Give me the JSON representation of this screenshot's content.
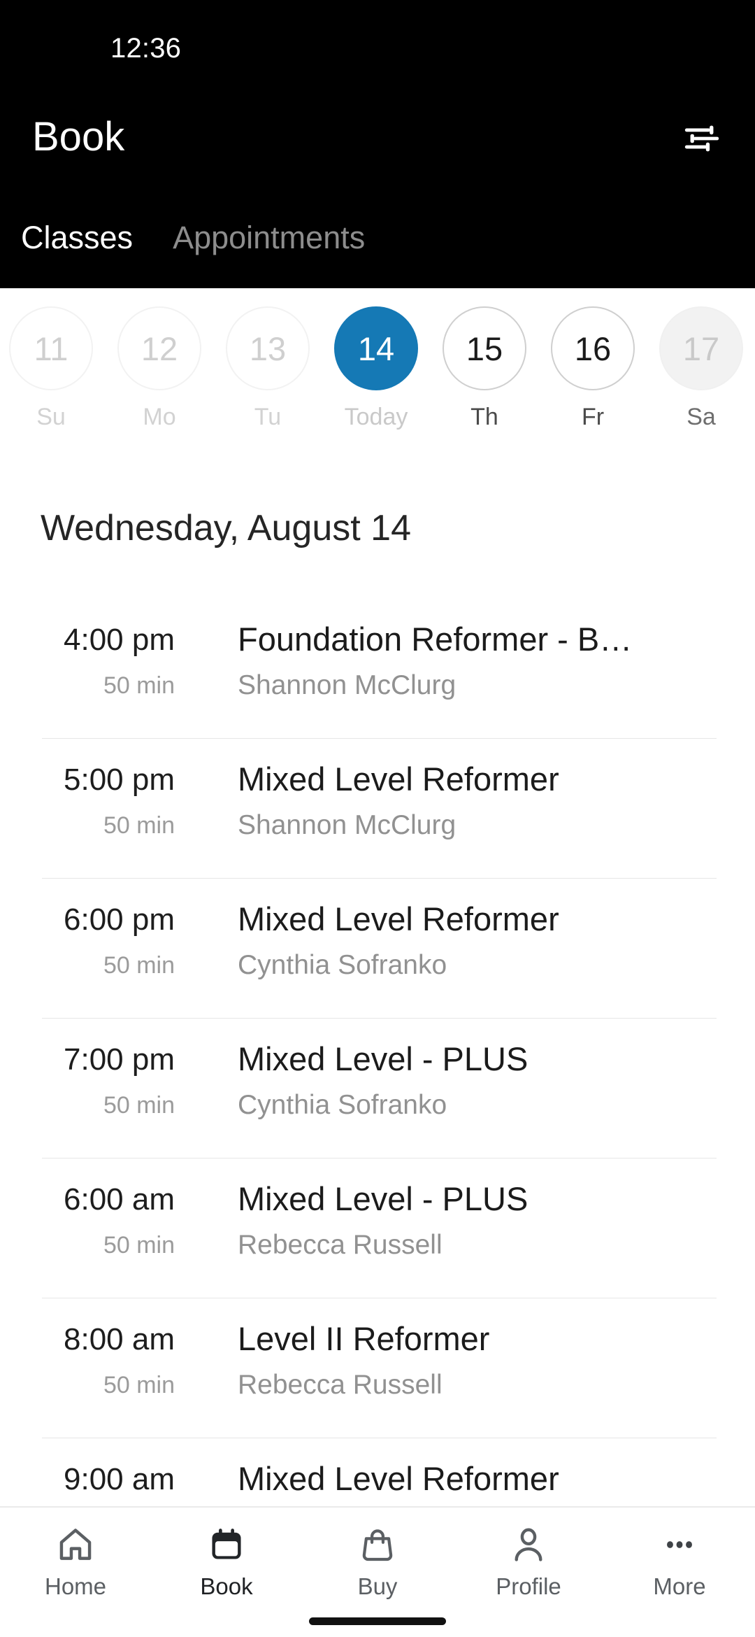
{
  "status_bar": {
    "time": "12:36"
  },
  "header": {
    "title": "Book",
    "filter_icon": "tune-filter-icon"
  },
  "tabs": [
    {
      "label": "Classes",
      "active": true
    },
    {
      "label": "Appointments",
      "active": false
    }
  ],
  "date_strip": {
    "days": [
      {
        "num": "11",
        "label": "Su",
        "state": "past"
      },
      {
        "num": "12",
        "label": "Mo",
        "state": "past"
      },
      {
        "num": "13",
        "label": "Tu",
        "state": "past"
      },
      {
        "num": "14",
        "label": "Today",
        "state": "selected"
      },
      {
        "num": "15",
        "label": "Th",
        "state": "avail"
      },
      {
        "num": "16",
        "label": "Fr",
        "state": "avail"
      },
      {
        "num": "17",
        "label": "Sa",
        "state": "filled"
      }
    ]
  },
  "day_heading": "Wednesday, August 14",
  "classes": [
    {
      "time": "4:00 pm",
      "duration": "50 min",
      "name": "Foundation Reformer - B…",
      "staff": "Shannon McClurg"
    },
    {
      "time": "5:00 pm",
      "duration": "50 min",
      "name": "Mixed Level Reformer",
      "staff": "Shannon McClurg"
    },
    {
      "time": "6:00 pm",
      "duration": "50 min",
      "name": "Mixed Level Reformer",
      "staff": "Cynthia Sofranko"
    },
    {
      "time": "7:00 pm",
      "duration": "50 min",
      "name": "Mixed Level - PLUS",
      "staff": "Cynthia Sofranko"
    },
    {
      "time": "6:00 am",
      "duration": "50 min",
      "name": "Mixed Level - PLUS",
      "staff": "Rebecca Russell"
    },
    {
      "time": "8:00 am",
      "duration": "50 min",
      "name": "Level II Reformer",
      "staff": "Rebecca Russell"
    },
    {
      "time": "9:00 am",
      "duration": "",
      "name": "Mixed Level Reformer",
      "staff": ""
    }
  ],
  "bottom_nav": {
    "items": [
      {
        "label": "Home",
        "icon": "home-icon",
        "active": false
      },
      {
        "label": "Book",
        "icon": "calendar-icon",
        "active": true
      },
      {
        "label": "Buy",
        "icon": "shopping-bag-icon",
        "active": false
      },
      {
        "label": "Profile",
        "icon": "person-icon",
        "active": false
      },
      {
        "label": "More",
        "icon": "ellipsis-icon",
        "active": false
      }
    ]
  },
  "colors": {
    "accent_blue": "#1579b5",
    "header_bg": "#000000",
    "divider": "#e6e6e6",
    "muted_text": "#919191"
  }
}
